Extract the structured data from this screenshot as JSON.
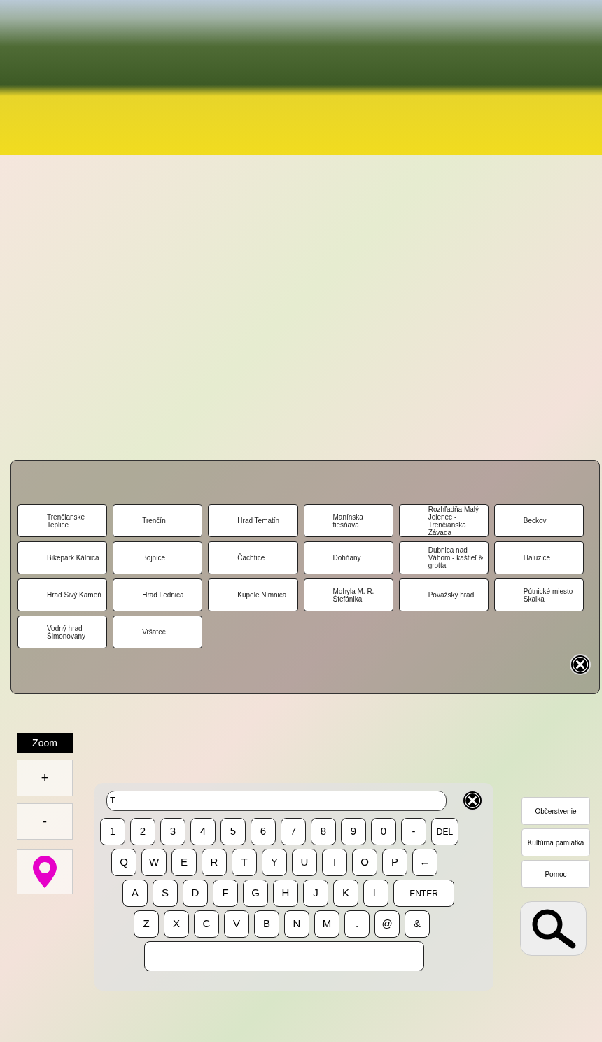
{
  "places": [
    {
      "label": "Trenčianske Teplice"
    },
    {
      "label": "Trenčín"
    },
    {
      "label": "Hrad Tematín"
    },
    {
      "label": "Manínska tiesňava"
    },
    {
      "label": "Rozhľadňa Malý Jelenec - Trenčianska Závada"
    },
    {
      "label": "Beckov"
    },
    {
      "label": "Bikepark Kálnica"
    },
    {
      "label": "Bojnice"
    },
    {
      "label": "Čachtice"
    },
    {
      "label": "Dohňany"
    },
    {
      "label": "Dubnica nad Váhom - kaštieľ & grotta"
    },
    {
      "label": "Haluzice"
    },
    {
      "label": "Hrad Sivý Kameň"
    },
    {
      "label": "Hrad Lednica"
    },
    {
      "label": "Kúpele Nimnica"
    },
    {
      "label": "Mohyla M. R. Štefánika"
    },
    {
      "label": "Považský hrad"
    },
    {
      "label": "Pútnické miesto Skalka"
    },
    {
      "label": "Vodný hrad Šimonovany"
    },
    {
      "label": "Vršatec"
    }
  ],
  "zoom": {
    "title": "Zoom",
    "buttons": [
      "+",
      "-"
    ]
  },
  "keyboard": {
    "input": {
      "value": "T"
    },
    "rows": [
      [
        {
          "label": "1",
          "kind": "char"
        },
        {
          "label": "2",
          "kind": "char"
        },
        {
          "label": "3",
          "kind": "char"
        },
        {
          "label": "4",
          "kind": "char"
        },
        {
          "label": "5",
          "kind": "char"
        },
        {
          "label": "6",
          "kind": "char"
        },
        {
          "label": "7",
          "kind": "char"
        },
        {
          "label": "8",
          "kind": "char"
        },
        {
          "label": "9",
          "kind": "char"
        },
        {
          "label": "0",
          "kind": "char"
        },
        {
          "label": "-",
          "kind": "char"
        },
        {
          "label": "DEL",
          "kind": "small"
        }
      ],
      [
        {
          "label": "Q",
          "kind": "char"
        },
        {
          "label": "W",
          "kind": "char"
        },
        {
          "label": "E",
          "kind": "char"
        },
        {
          "label": "R",
          "kind": "char"
        },
        {
          "label": "T",
          "kind": "char"
        },
        {
          "label": "Y",
          "kind": "char"
        },
        {
          "label": "U",
          "kind": "char"
        },
        {
          "label": "I",
          "kind": "char"
        },
        {
          "label": "O",
          "kind": "char"
        },
        {
          "label": "P",
          "kind": "char"
        },
        {
          "label": "←",
          "kind": "char"
        }
      ],
      [
        {
          "label": "A",
          "kind": "char"
        },
        {
          "label": "S",
          "kind": "char"
        },
        {
          "label": "D",
          "kind": "char"
        },
        {
          "label": "F",
          "kind": "char"
        },
        {
          "label": "G",
          "kind": "char"
        },
        {
          "label": "H",
          "kind": "char"
        },
        {
          "label": "J",
          "kind": "char"
        },
        {
          "label": "K",
          "kind": "char"
        },
        {
          "label": "L",
          "kind": "char"
        },
        {
          "label": "ENTER",
          "kind": "wide"
        }
      ],
      [
        {
          "label": "Z",
          "kind": "char"
        },
        {
          "label": "X",
          "kind": "char"
        },
        {
          "label": "C",
          "kind": "char"
        },
        {
          "label": "V",
          "kind": "char"
        },
        {
          "label": "B",
          "kind": "char"
        },
        {
          "label": "N",
          "kind": "char"
        },
        {
          "label": "M",
          "kind": "char"
        },
        {
          "label": ".",
          "kind": "char"
        },
        {
          "label": "@",
          "kind": "char"
        },
        {
          "label": "&",
          "kind": "char"
        }
      ]
    ]
  },
  "side_buttons": [
    {
      "label": "Občerstvenie"
    },
    {
      "label": "Kultúrna pamiatka"
    },
    {
      "label": "Pomoc"
    }
  ]
}
